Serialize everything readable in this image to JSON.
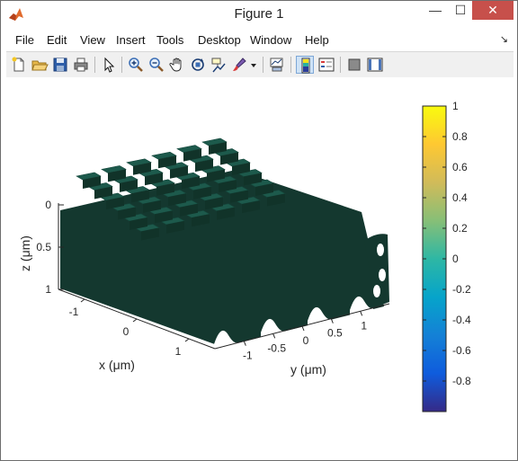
{
  "window": {
    "title": "Figure 1",
    "min_glyph": "—",
    "max_glyph": "☐",
    "close_glyph": "✕"
  },
  "menu": {
    "items": [
      "File",
      "Edit",
      "View",
      "Insert",
      "Tools",
      "Desktop",
      "Window",
      "Help"
    ],
    "dock_glyph": "↘"
  },
  "toolbar": {
    "icons": [
      "new-figure-icon",
      "open-file-icon",
      "save-icon",
      "print-icon",
      "pointer-icon",
      "zoom-in-icon",
      "zoom-out-icon",
      "pan-icon",
      "rotate-3d-icon",
      "data-cursor-icon",
      "brush-icon",
      "brush-dropdown-icon",
      "link-plot-icon",
      "colorbar-icon",
      "legend-icon",
      "hide-plot-tools-icon",
      "show-plot-tools-icon"
    ],
    "pressed": "colorbar-icon"
  },
  "chart_data": {
    "type": "surface-3d",
    "title": "",
    "xlabel": "x (μm)",
    "ylabel": "y (μm)",
    "zlabel": "z (μm)",
    "x_ticks": [
      "-1",
      "0",
      "1"
    ],
    "y_ticks": [
      "-1",
      "-0.5",
      "0",
      "0.5",
      "1"
    ],
    "z_ticks": [
      "0",
      "0.5",
      "1"
    ],
    "z_direction": "reverse",
    "surface_color": "#14382f",
    "top_face_color": "#1d5a4c",
    "pillar_grid": {
      "rows": 6,
      "columns": 6
    },
    "colorbar": {
      "ticks": [
        "1",
        "0.8",
        "0.6",
        "0.4",
        "0.2",
        "0",
        "-0.2",
        "-0.4",
        "-0.6",
        "-0.8"
      ],
      "tick_values": [
        1,
        0.8,
        0.6,
        0.4,
        0.2,
        0,
        -0.2,
        -0.4,
        -0.6,
        -0.8
      ],
      "range": [
        -1,
        1
      ],
      "colormap": "parula",
      "colormap_stops": [
        "#352a87",
        "#0f5cdd",
        "#1481d6",
        "#06a4ca",
        "#2eb7a4",
        "#87bf77",
        "#d1bb59",
        "#fec832",
        "#f9fb0e"
      ]
    }
  }
}
